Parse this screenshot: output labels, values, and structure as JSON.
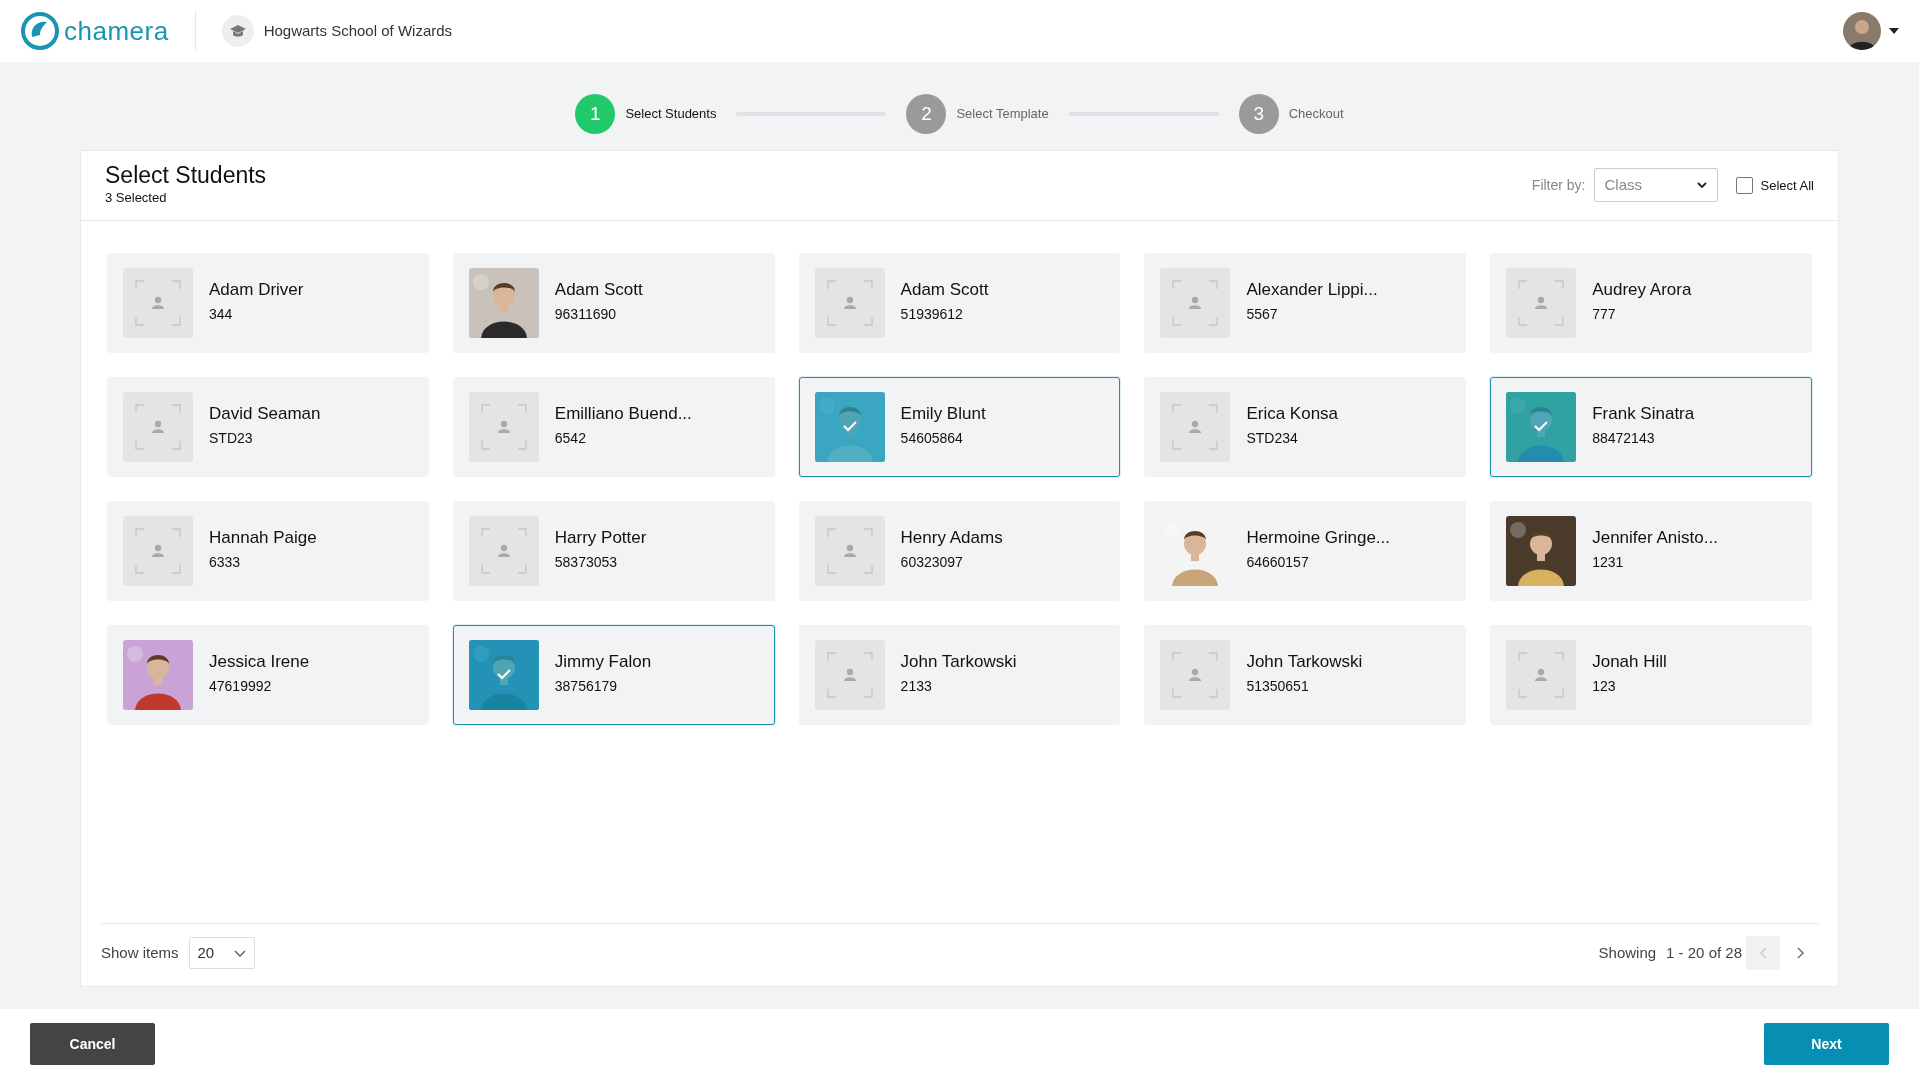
{
  "header": {
    "logo": "chamera",
    "school": "Hogwarts School of Wizards"
  },
  "steps": [
    {
      "number": "1",
      "label": "Select Students",
      "active": true
    },
    {
      "number": "2",
      "label": "Select Template",
      "active": false
    },
    {
      "number": "3",
      "label": "Checkout",
      "active": false
    }
  ],
  "panel": {
    "title": "Select Students",
    "subtitle": "3 Selected",
    "filter_label": "Filter by:",
    "filter": {
      "placeholder": "Class"
    },
    "select_all": {
      "label": "Select All",
      "checked": false
    }
  },
  "students": [
    {
      "name": "Adam Driver",
      "id": "344",
      "kind": "placeholder",
      "selected": false
    },
    {
      "name": "Adam Scott",
      "id": "96311690",
      "kind": "picture",
      "selected": false
    },
    {
      "name": "Adam Scott",
      "id": "51939612",
      "kind": "placeholder",
      "selected": false
    },
    {
      "name": "Alexander Lippi...",
      "id": "5567",
      "kind": "placeholder",
      "selected": false
    },
    {
      "name": "Audrey Arora",
      "id": "777",
      "kind": "placeholder",
      "selected": false
    },
    {
      "name": "David Seaman",
      "id": "STD23",
      "kind": "placeholder",
      "selected": false
    },
    {
      "name": "Emilliano Buend...",
      "id": "6542",
      "kind": "placeholder",
      "selected": false
    },
    {
      "name": "Emily Blunt",
      "id": "54605864",
      "kind": "picture",
      "selected": true
    },
    {
      "name": "Erica Konsa",
      "id": "STD234",
      "kind": "placeholder",
      "selected": false
    },
    {
      "name": "Frank Sinatra",
      "id": "88472143",
      "kind": "picture",
      "selected": true
    },
    {
      "name": "Hannah Paige",
      "id": "6333",
      "kind": "placeholder",
      "selected": false
    },
    {
      "name": "Harry Potter",
      "id": "58373053",
      "kind": "placeholder",
      "selected": false
    },
    {
      "name": "Henry Adams",
      "id": "60323097",
      "kind": "placeholder",
      "selected": false
    },
    {
      "name": "Hermoine Gringe...",
      "id": "64660157",
      "kind": "picture",
      "selected": false
    },
    {
      "name": "Jennifer Anisto...",
      "id": "1231",
      "kind": "picture",
      "selected": false
    },
    {
      "name": "Jessica Irene",
      "id": "47619992",
      "kind": "picture",
      "selected": false
    },
    {
      "name": "Jimmy Falon",
      "id": "38756179",
      "kind": "picture",
      "selected": true
    },
    {
      "name": "John Tarkowski",
      "id": "2133",
      "kind": "placeholder",
      "selected": false
    },
    {
      "name": "John Tarkowski",
      "id": "51350651",
      "kind": "placeholder",
      "selected": false
    },
    {
      "name": "Jonah Hill",
      "id": "123",
      "kind": "placeholder",
      "selected": false
    }
  ],
  "pagination": {
    "show_items_label": "Show items",
    "per_page": "20",
    "showing_label": "Showing",
    "range": "1 - 20 of 28",
    "prev_disabled": true,
    "next_disabled": false
  },
  "footer": {
    "cancel": "Cancel",
    "next": "Next"
  }
}
